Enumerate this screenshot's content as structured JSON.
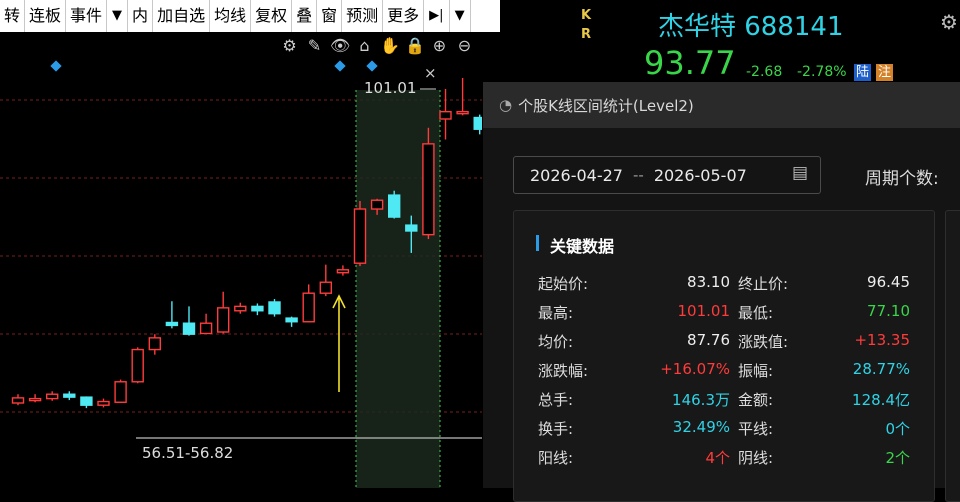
{
  "toolbar": {
    "items": [
      "转",
      "连板",
      "事件",
      "▼",
      "内",
      "加自选",
      "均线",
      "复权",
      "叠",
      "窗",
      "预测",
      "更多",
      "▶|",
      "▼"
    ]
  },
  "chart_tools": [
    "⚙",
    "✎",
    "👁",
    "⌂",
    "✋",
    "🔒",
    "⊕",
    "⊖"
  ],
  "chart": {
    "high_label": "101.01",
    "range_label": "56.51-56.82",
    "close_label": "×"
  },
  "quote": {
    "kr": [
      "K",
      "R"
    ],
    "name": "杰华特 688141",
    "price": "93.77",
    "change": "-2.68",
    "change_pct": "-2.78%",
    "badge_lu": "陆",
    "badge_zhu": "注"
  },
  "panel": {
    "title": "个股K线区间统计(Level2)",
    "date_start": "2026-04-27",
    "date_sep": "--",
    "date_end": "2026-05-07",
    "cycles_label": "周期个数:",
    "section_title": "关键数据",
    "rows": [
      {
        "k1": "起始价:",
        "v1": "83.10",
        "c1": "white",
        "k2": "终止价:",
        "v2": "96.45",
        "c2": "white"
      },
      {
        "k1": "最高:",
        "v1": "101.01",
        "c1": "red",
        "k2": "最低:",
        "v2": "77.10",
        "c2": "green"
      },
      {
        "k1": "均价:",
        "v1": "87.76",
        "c1": "white",
        "k2": "涨跌值:",
        "v2": "+13.35",
        "c2": "red"
      },
      {
        "k1": "涨跌幅:",
        "v1": "+16.07%",
        "c1": "red",
        "k2": "振幅:",
        "v2": "28.77%",
        "c2": "cyan"
      },
      {
        "k1": "总手:",
        "v1": "146.3万",
        "c1": "cyan",
        "k2": "金额:",
        "v2": "128.4亿",
        "c2": "cyan"
      },
      {
        "k1": "换手:",
        "v1": "32.49%",
        "c1": "cyan",
        "k2": "平线:",
        "v2": "0个",
        "c2": "cyan"
      },
      {
        "k1": "阳线:",
        "v1": "4个",
        "c1": "red",
        "k2": "阴线:",
        "v2": "2个",
        "c2": "green"
      }
    ]
  },
  "candles": [
    {
      "o": 56.6,
      "c": 57.3,
      "h": 57.8,
      "l": 56.3
    },
    {
      "o": 57.0,
      "c": 57.2,
      "h": 57.8,
      "l": 56.7
    },
    {
      "o": 57.2,
      "c": 57.8,
      "h": 58.2,
      "l": 56.9
    },
    {
      "o": 57.8,
      "c": 57.4,
      "h": 58.2,
      "l": 57.0
    },
    {
      "o": 57.4,
      "c": 56.3,
      "h": 57.5,
      "l": 55.9
    },
    {
      "o": 56.3,
      "c": 56.8,
      "h": 57.2,
      "l": 56.0
    },
    {
      "o": 56.7,
      "c": 59.5,
      "h": 59.8,
      "l": 56.6
    },
    {
      "o": 59.5,
      "c": 63.9,
      "h": 64.2,
      "l": 59.3
    },
    {
      "o": 63.9,
      "c": 65.5,
      "h": 66.0,
      "l": 63.2
    },
    {
      "o": 67.6,
      "c": 67.2,
      "h": 70.5,
      "l": 66.8
    },
    {
      "o": 67.5,
      "c": 66.0,
      "h": 69.8,
      "l": 65.8
    },
    {
      "o": 66.1,
      "c": 67.5,
      "h": 68.8,
      "l": 66.0
    },
    {
      "o": 66.3,
      "c": 69.6,
      "h": 71.8,
      "l": 66.1
    },
    {
      "o": 69.2,
      "c": 69.8,
      "h": 70.3,
      "l": 68.8
    },
    {
      "o": 69.8,
      "c": 69.2,
      "h": 70.2,
      "l": 68.6
    },
    {
      "o": 70.4,
      "c": 68.8,
      "h": 70.8,
      "l": 68.4
    },
    {
      "o": 68.2,
      "c": 67.7,
      "h": 68.4,
      "l": 67.0
    },
    {
      "o": 67.7,
      "c": 71.6,
      "h": 72.8,
      "l": 67.6
    },
    {
      "o": 71.6,
      "c": 73.1,
      "h": 75.5,
      "l": 71.2
    },
    {
      "o": 74.4,
      "c": 74.8,
      "h": 75.4,
      "l": 74.0
    },
    {
      "o": 75.7,
      "c": 83.1,
      "h": 84.2,
      "l": 75.3
    },
    {
      "o": 83.1,
      "c": 84.3,
      "h": 84.5,
      "l": 82.3
    },
    {
      "o": 85.0,
      "c": 82.0,
      "h": 85.6,
      "l": 81.8
    },
    {
      "o": 80.9,
      "c": 80.1,
      "h": 82.2,
      "l": 77.1
    },
    {
      "o": 79.6,
      "c": 92.0,
      "h": 94.2,
      "l": 79.0
    },
    {
      "o": 95.4,
      "c": 96.4,
      "h": 99.5,
      "l": 92.6
    },
    {
      "o": 96.4,
      "c": 96.4,
      "h": 101.0,
      "l": 95.9
    },
    {
      "o": 95.6,
      "c": 94.0,
      "h": 96.0,
      "l": 93.3
    }
  ]
}
